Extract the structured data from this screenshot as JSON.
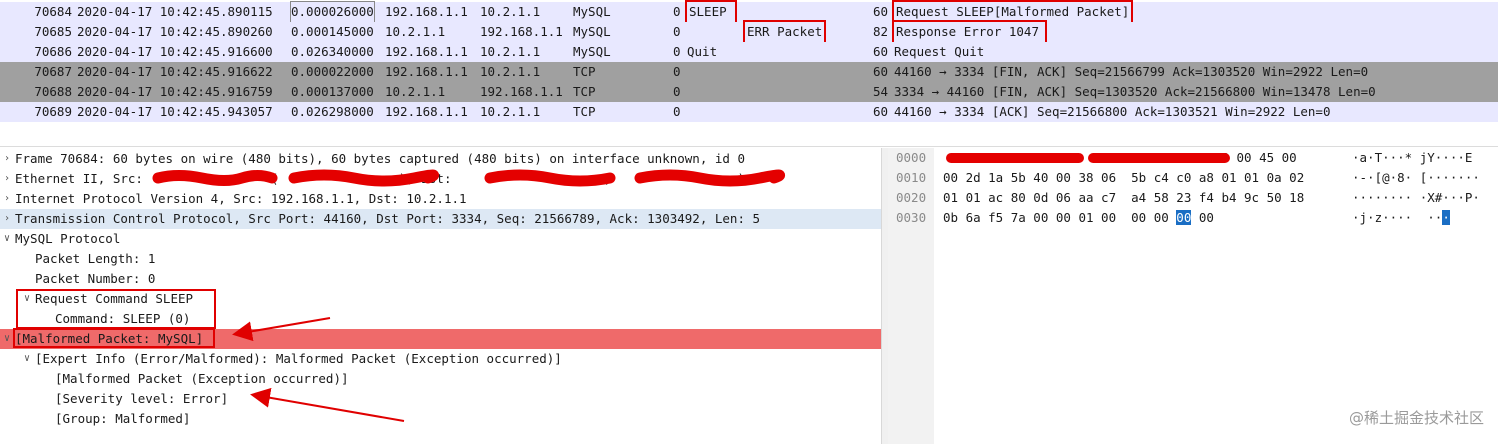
{
  "colors": {
    "mysql_row": "#e8e8ff",
    "tcp_fin_row": "#a0a0a0",
    "tcp_row": "#e8e8ff",
    "selected_detail": "#dde8f4",
    "malformed": "#ef6a6a",
    "annotation": "#e00000",
    "hex_highlight": "#1a6ec4"
  },
  "packet_list": {
    "rows": [
      {
        "no": "70684",
        "time": "2020-04-17 10:42:45.890115",
        "delta": "0.000026000",
        "src": "192.168.1.1",
        "dst": "10.2.1.1",
        "proto": "MySQL",
        "flag": "0",
        "info_mid": "SLEEP",
        "info_extra": "",
        "len": "60",
        "info": "Request SLEEP[Malformed Packet]",
        "tint": "mysql_row"
      },
      {
        "no": "70685",
        "time": "2020-04-17 10:42:45.890260",
        "delta": "0.000145000",
        "src": "10.2.1.1",
        "dst": "192.168.1.1",
        "proto": "MySQL",
        "flag": "0",
        "info_mid": "",
        "info_extra": "ERR Packet",
        "len": "82",
        "info": "Response Error 1047",
        "tint": "mysql_row"
      },
      {
        "no": "70686",
        "time": "2020-04-17 10:42:45.916600",
        "delta": "0.026340000",
        "src": "192.168.1.1",
        "dst": "10.2.1.1",
        "proto": "MySQL",
        "flag": "0",
        "info_mid": "Quit",
        "info_extra": "",
        "len": "60",
        "info": "Request Quit",
        "tint": "mysql_row"
      },
      {
        "no": "70687",
        "time": "2020-04-17 10:42:45.916622",
        "delta": "0.000022000",
        "src": "192.168.1.1",
        "dst": "10.2.1.1",
        "proto": "TCP",
        "flag": "0",
        "info_mid": "",
        "info_extra": "",
        "len": "60",
        "info": "44160 → 3334 [FIN, ACK] Seq=21566799 Ack=1303520 Win=2922 Len=0",
        "tint": "tcp_fin_row"
      },
      {
        "no": "70688",
        "time": "2020-04-17 10:42:45.916759",
        "delta": "0.000137000",
        "src": "10.2.1.1",
        "dst": "192.168.1.1",
        "proto": "TCP",
        "flag": "0",
        "info_mid": "",
        "info_extra": "",
        "len": "54",
        "info": "3334 → 44160 [FIN, ACK] Seq=1303520 Ack=21566800 Win=13478 Len=0",
        "tint": "tcp_fin_row"
      },
      {
        "no": "70689",
        "time": "2020-04-17 10:42:45.943057",
        "delta": "0.026298000",
        "src": "192.168.1.1",
        "dst": "10.2.1.1",
        "proto": "TCP",
        "flag": "0",
        "info_mid": "",
        "info_extra": "",
        "len": "60",
        "info": "44160 → 3334 [ACK] Seq=21566800 Ack=1303521 Win=2922 Len=0",
        "tint": "tcp_row"
      }
    ]
  },
  "details": {
    "rows": [
      {
        "indent": 0,
        "toggle": ">",
        "text": "Frame 70684: 60 bytes on wire (480 bits), 60 bytes captured (480 bits) on interface unknown, id 0",
        "style": "normal"
      },
      {
        "indent": 0,
        "toggle": ">",
        "text": "Ethernet II, Src:                 (                ), Dst:                    (                 )",
        "style": "normal"
      },
      {
        "indent": 0,
        "toggle": ">",
        "text": "Internet Protocol Version 4, Src: 192.168.1.1, Dst: 10.2.1.1",
        "style": "normal"
      },
      {
        "indent": 0,
        "toggle": ">",
        "text": "Transmission Control Protocol, Src Port: 44160, Dst Port: 3334, Seq: 21566789, Ack: 1303492, Len: 5",
        "style": "selected"
      },
      {
        "indent": 0,
        "toggle": "v",
        "text": "MySQL Protocol",
        "style": "normal"
      },
      {
        "indent": 1,
        "toggle": "",
        "text": "Packet Length: 1",
        "style": "normal"
      },
      {
        "indent": 1,
        "toggle": "",
        "text": "Packet Number: 0",
        "style": "normal"
      },
      {
        "indent": 1,
        "toggle": "v",
        "text": "Request Command SLEEP",
        "style": "normal"
      },
      {
        "indent": 2,
        "toggle": "",
        "text": "Command: SLEEP (0)",
        "style": "normal"
      },
      {
        "indent": 0,
        "toggle": "v",
        "text": "[Malformed Packet: MySQL]",
        "style": "malformed"
      },
      {
        "indent": 1,
        "toggle": "v",
        "text": "[Expert Info (Error/Malformed): Malformed Packet (Exception occurred)]",
        "style": "normal"
      },
      {
        "indent": 2,
        "toggle": "",
        "text": "[Malformed Packet (Exception occurred)]",
        "style": "normal"
      },
      {
        "indent": 2,
        "toggle": "",
        "text": "[Severity level: Error]",
        "style": "normal"
      },
      {
        "indent": 2,
        "toggle": "",
        "text": "[Group: Malformed]",
        "style": "normal"
      }
    ]
  },
  "hex": {
    "rows": [
      {
        "offset": "0000",
        "bytes": "                                    08 00 45 00",
        "ascii": "·a·T···* jY····E"
      },
      {
        "offset": "0010",
        "bytes": "00 2d 1a 5b 40 00 38 06  5b c4 c0 a8 01 01 0a 02",
        "ascii": "·-·[@·8· [·······"
      },
      {
        "offset": "0020",
        "bytes": "01 01 ac 80 0d 06 aa c7  a4 58 23 f4 b4 9c 50 18",
        "ascii": "········ ·X#···P·"
      },
      {
        "offset": "0030",
        "bytes_pre": "0b 6a f5 7a 00 00 01 00  00 00 ",
        "bytes_hl": "00",
        "bytes_post": " 00",
        "ascii_pre": "·j·z····  ··",
        "ascii_hl": "·"
      }
    ]
  },
  "watermark": "@稀土掘金技术社区"
}
